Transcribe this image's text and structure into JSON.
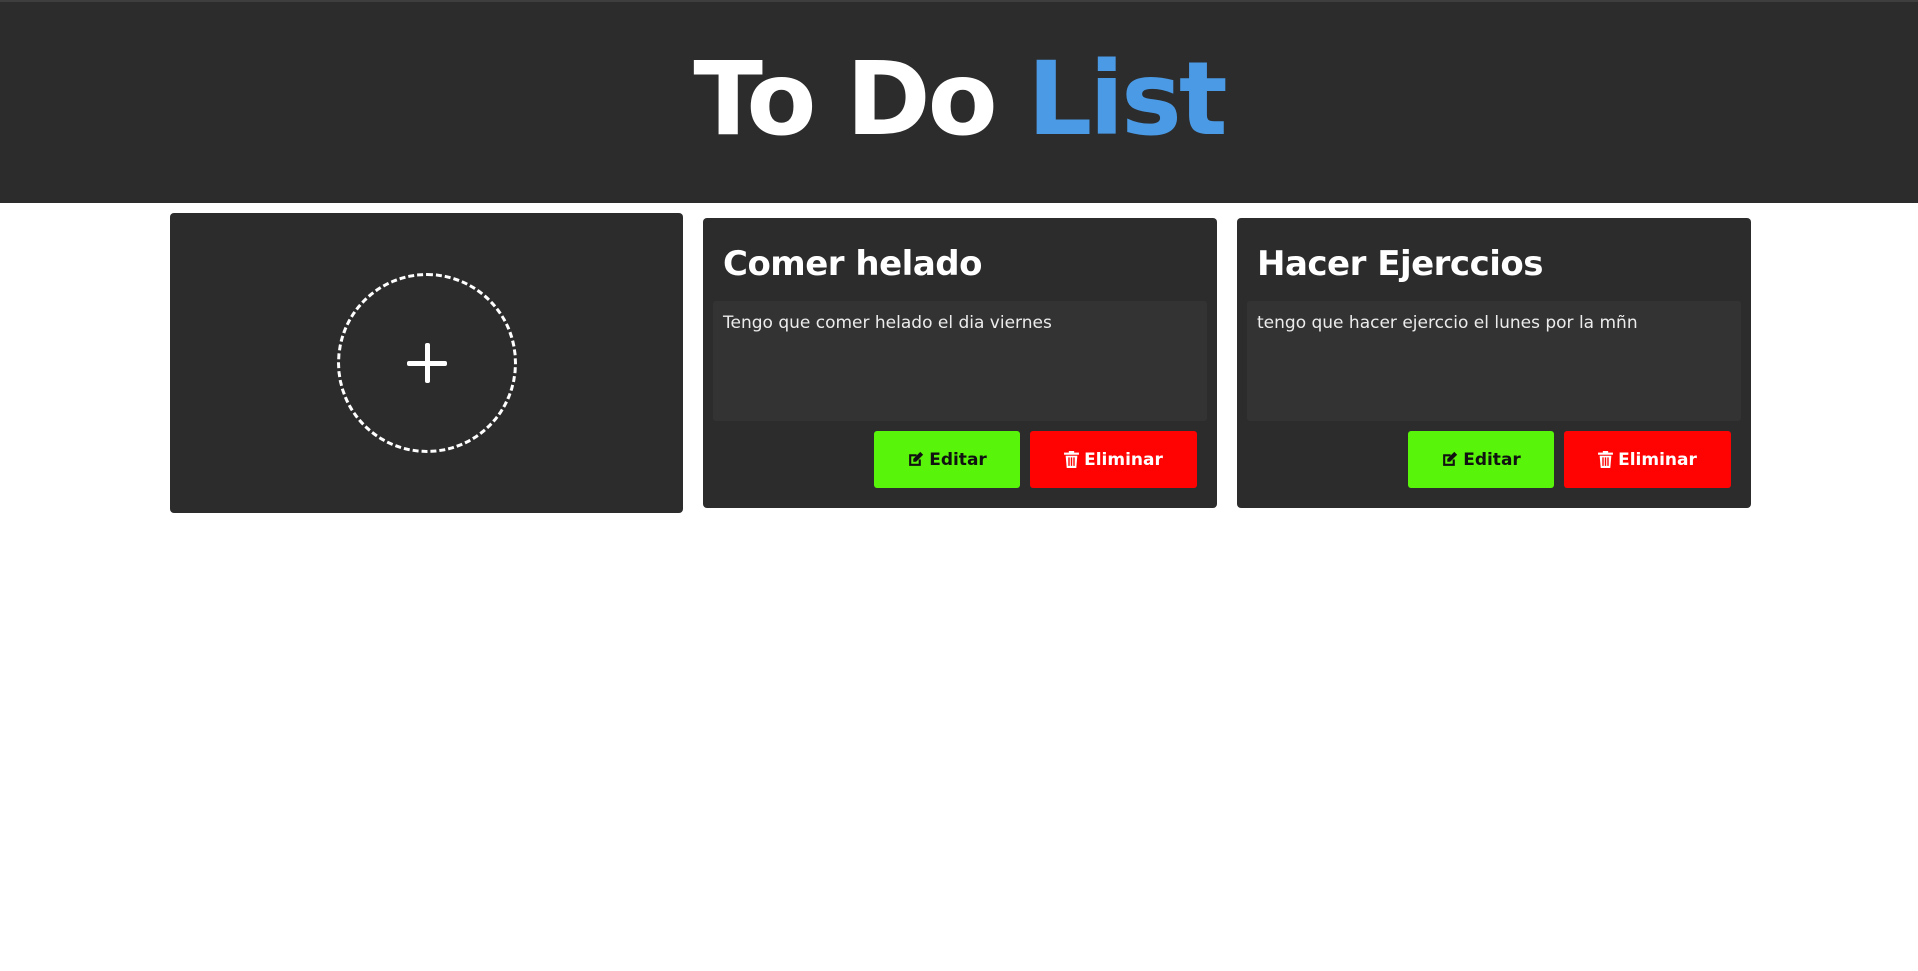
{
  "header": {
    "title_main": "To Do ",
    "title_accent": "List"
  },
  "add_card": {
    "icon": "plus-icon"
  },
  "tasks": [
    {
      "title": "Comer helado",
      "description": "Tengo que comer helado el dia viernes",
      "edit_label": "Editar",
      "delete_label": "Eliminar"
    },
    {
      "title": "Hacer Ejerccios",
      "description": "tengo que hacer ejerccio el lunes por la mñn",
      "edit_label": "Editar",
      "delete_label": "Eliminar"
    }
  ],
  "colors": {
    "header_bg": "#2c2c2c",
    "accent": "#4a9ae6",
    "edit": "#58f40a",
    "delete": "#ff0303"
  }
}
